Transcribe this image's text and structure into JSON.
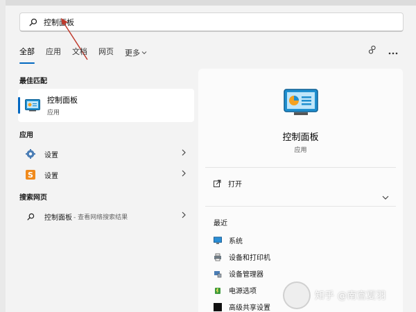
{
  "search": {
    "value": "控制面板"
  },
  "tabs": [
    "全部",
    "应用",
    "文档",
    "网页",
    "更多"
  ],
  "left": {
    "best_match_title": "最佳匹配",
    "best_match": {
      "name": "控制面板",
      "type": "应用"
    },
    "apps_title": "应用",
    "apps": [
      {
        "label": "设置",
        "icon": "gear-icon"
      },
      {
        "label": "设置",
        "icon": "s-app-icon"
      }
    ],
    "web_title": "搜索网页",
    "web_item": {
      "label": "控制面板",
      "sub": "- 查看网络搜索结果"
    }
  },
  "right": {
    "title": "控制面板",
    "subtitle": "应用",
    "open_label": "打开",
    "recent_title": "最近",
    "recent": [
      {
        "label": "系统",
        "icon": "monitor-icon"
      },
      {
        "label": "设备和打印机",
        "icon": "printer-icon"
      },
      {
        "label": "设备管理器",
        "icon": "device-manager-icon"
      },
      {
        "label": "电源选项",
        "icon": "power-icon"
      },
      {
        "label": "高级共享设置",
        "icon": "share-icon"
      }
    ]
  },
  "watermark": {
    "text": "知乎 @南宫夏羽"
  },
  "colors": {
    "accent": "#0067c0",
    "background": "#f3f3f3",
    "annotation": "#c0392b"
  }
}
